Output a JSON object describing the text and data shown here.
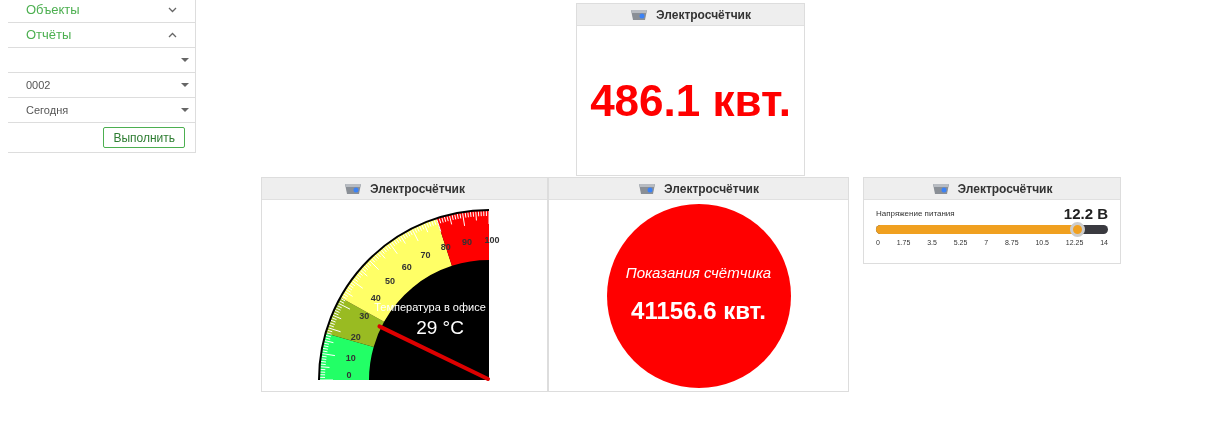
{
  "sidebar": {
    "items": [
      {
        "label": "Объекты",
        "expanded": false
      },
      {
        "label": "Отчёты",
        "expanded": true
      }
    ],
    "fields": [
      {
        "kind": "select"
      },
      {
        "kind": "select",
        "value": "0002"
      },
      {
        "kind": "select",
        "value": "Сегодня"
      }
    ],
    "button": "Выполнить"
  },
  "widgets": [
    {
      "kind": "value",
      "title": "Электросчётчик",
      "value": "486.1 квт."
    },
    {
      "kind": "gauge",
      "title": "Электросчётчик",
      "label": "Температура в офисе",
      "reading": "29 °C",
      "ticks": [
        "100",
        "90",
        "80",
        "70",
        "60",
        "50",
        "40",
        "30",
        "20",
        "10",
        "0"
      ]
    },
    {
      "kind": "circle",
      "title": "Электросчётчик",
      "label": "Показания счётчика",
      "value": "41156.6 квт."
    },
    {
      "kind": "slider",
      "title": "Электросчётчик",
      "label": "Напряжение питания",
      "reading": "12.2 В",
      "level": 0.871,
      "ticks": [
        "0",
        "1.75",
        "3.5",
        "5.25",
        "7",
        "8.75",
        "10.5",
        "12.25",
        "14"
      ]
    }
  ]
}
